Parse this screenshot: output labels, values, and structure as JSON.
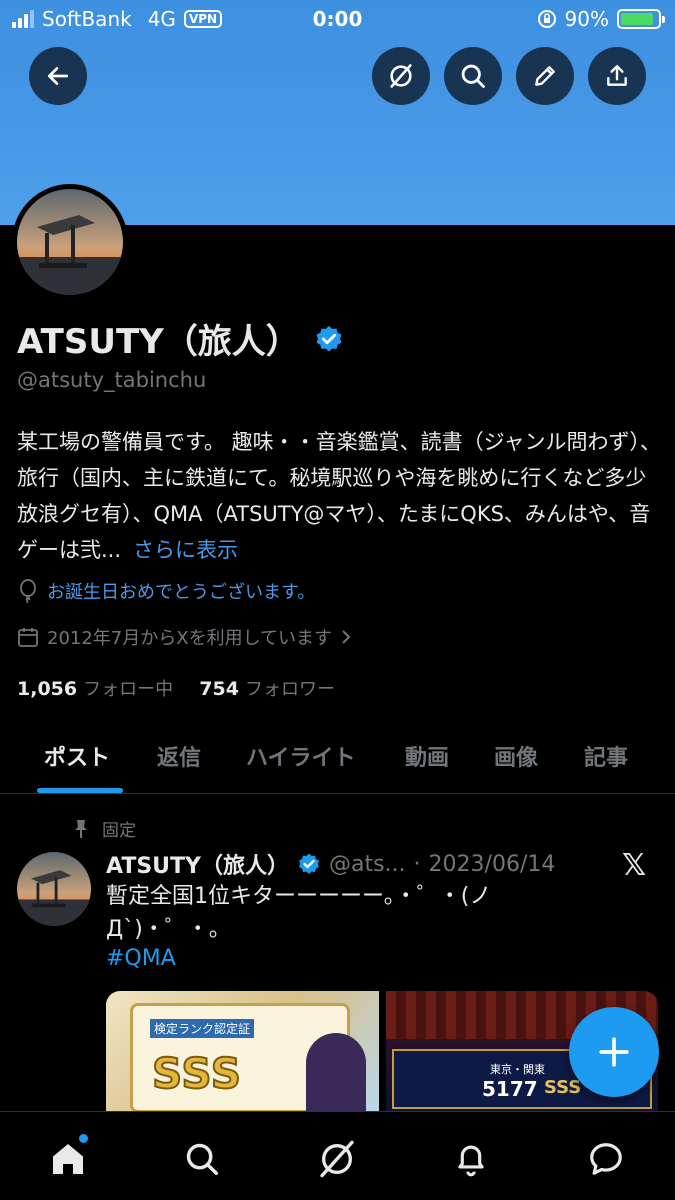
{
  "status_bar": {
    "carrier": "SoftBank",
    "network": "4G",
    "vpn": "VPN",
    "time": "0:00",
    "battery": "90%",
    "battery_level": 0.9
  },
  "header": {
    "back_icon": "arrow-left-icon",
    "buttons": [
      "grok-icon",
      "search-icon",
      "pencil-icon",
      "share-icon"
    ]
  },
  "profile": {
    "name": "ATSUTY（旅人）",
    "handle": "@atsuty_tabinchu",
    "bio": "某工場の警備員です。 趣味・・音楽鑑賞、読書（ジャンル問わず）、旅行（国内、主に鉄道にて。秘境駅巡りや海を眺めに行くなど多少放浪グセ有）、QMA（ATSUTY@マヤ）、たまにQKS、みんはや、音ゲーは弐...",
    "bio_more": "さらに表示",
    "birthday": "お誕生日おめでとうございます。",
    "joined": "2012年7月からXを利用しています",
    "following_count": "1,056",
    "following_label": "フォロー中",
    "followers_count": "754",
    "followers_label": "フォロワー"
  },
  "tabs": [
    "ポスト",
    "返信",
    "ハイライト",
    "動画",
    "画像",
    "記事"
  ],
  "post": {
    "pinned_label": "固定",
    "name": "ATSUTY（旅人）",
    "handle": "@ats...",
    "separator": "·",
    "date": "2023/06/14",
    "text": "暫定全国1位キターーーーー。・゜・(ノД`)・゜・。",
    "hashtag": "#QMA",
    "image1_text": "検定ランク認定証",
    "image1_rank": "SSS",
    "image2_text": "東京・関東",
    "image2_score": "5177",
    "image2_rank": "SSS"
  },
  "colors": {
    "accent": "#1d9bf0",
    "banner": "#4ea0ea",
    "secondary_text": "#71767b"
  },
  "bottom_nav": [
    "home-icon",
    "search-icon",
    "grok-icon",
    "bell-icon",
    "messages-icon"
  ]
}
